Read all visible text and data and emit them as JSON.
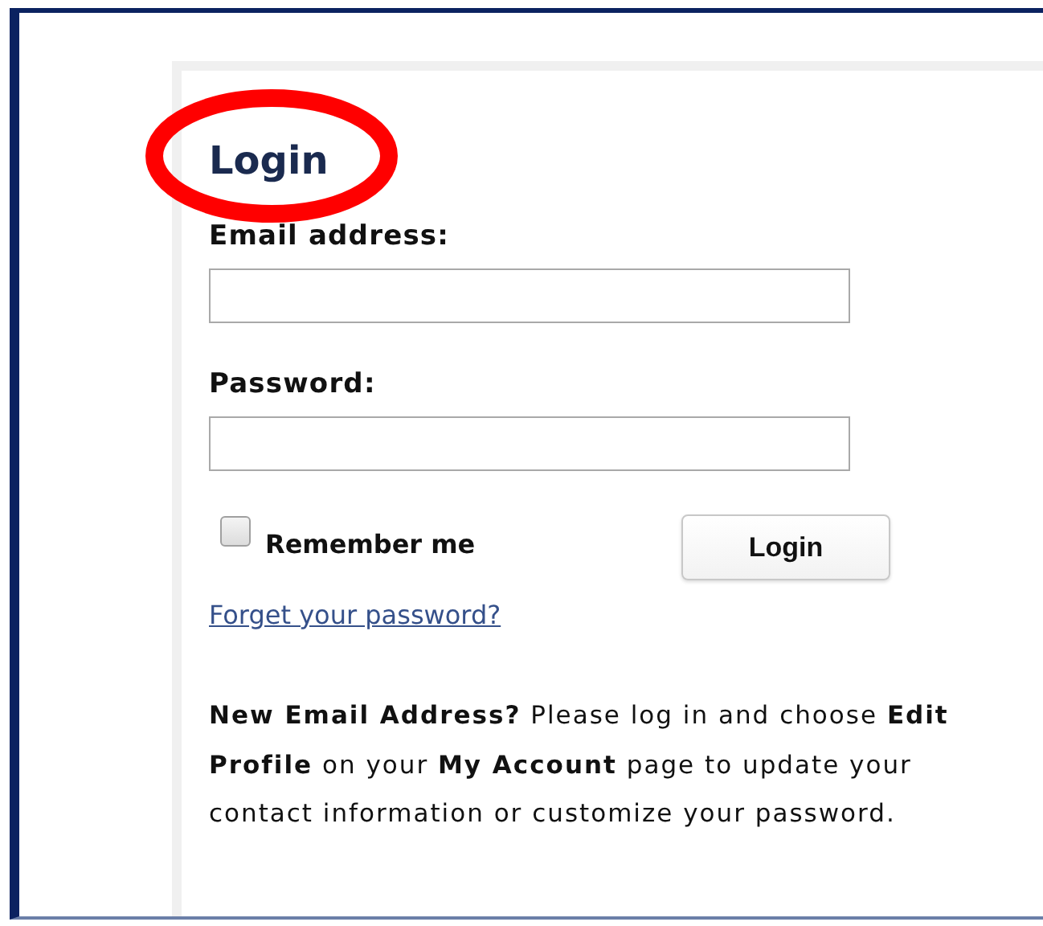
{
  "login_form": {
    "title": "Login",
    "fields": [
      {
        "label": "Email address:"
      },
      {
        "label": "Password:"
      }
    ],
    "remember_me": {
      "label": "Remember me",
      "checked": false
    },
    "submit_button": "Login",
    "forgot_link": "Forget your password?",
    "note": "**New Email Address?** Please log in and choose **Edit Profile** on your **My Account** page to update your contact information or customize your password."
  },
  "annotation": {
    "kind": "circle"
  }
}
